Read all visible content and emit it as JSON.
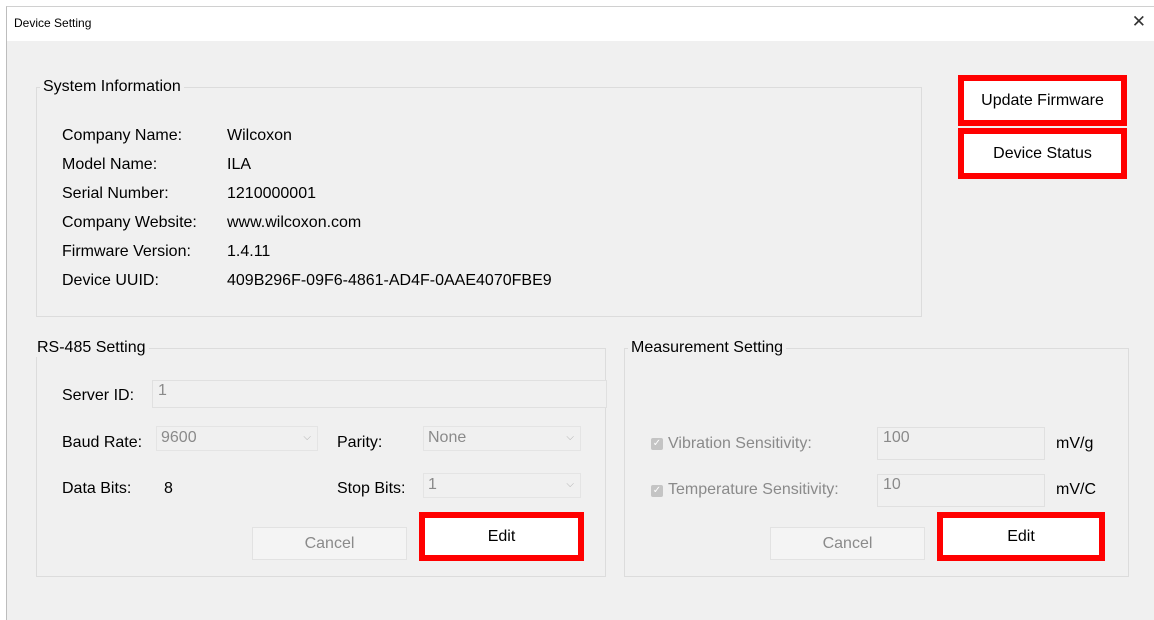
{
  "window": {
    "title": "Device Setting",
    "close_icon": "✕"
  },
  "system_info": {
    "legend": "System Information",
    "rows": [
      {
        "label": "Company Name:",
        "value": "Wilcoxon"
      },
      {
        "label": "Model Name:",
        "value": "ILA"
      },
      {
        "label": "Serial Number:",
        "value": "1210000001"
      },
      {
        "label": "Company Website:",
        "value": "www.wilcoxon.com"
      },
      {
        "label": "Firmware Version:",
        "value": "1.4.11"
      },
      {
        "label": "Device UUID:",
        "value": "409B296F-09F6-4861-AD4F-0AAE4070FBE9"
      }
    ]
  },
  "actions": {
    "update_firmware": "Update Firmware",
    "device_status": "Device Status"
  },
  "rs485": {
    "legend": "RS-485 Setting",
    "server_id_label": "Server ID:",
    "server_id_value": "1",
    "baud_rate_label": "Baud Rate:",
    "baud_rate_value": "9600",
    "parity_label": "Parity:",
    "parity_value": "None",
    "data_bits_label": "Data Bits:",
    "data_bits_value": "8",
    "stop_bits_label": "Stop Bits:",
    "stop_bits_value": "1",
    "cancel_label": "Cancel",
    "edit_label": "Edit"
  },
  "measurement": {
    "legend": "Measurement Setting",
    "vibration_label": "Vibration Sensitivity:",
    "vibration_value": "100",
    "vibration_unit": "mV/g",
    "vibration_checked": true,
    "temperature_label": "Temperature Sensitivity:",
    "temperature_value": "10",
    "temperature_unit": "mV/C",
    "temperature_checked": true,
    "cancel_label": "Cancel",
    "edit_label": "Edit"
  },
  "colors": {
    "highlight": "#ff0000",
    "window_bg": "#f0f0f0",
    "disabled_text": "#8a8a8a"
  }
}
